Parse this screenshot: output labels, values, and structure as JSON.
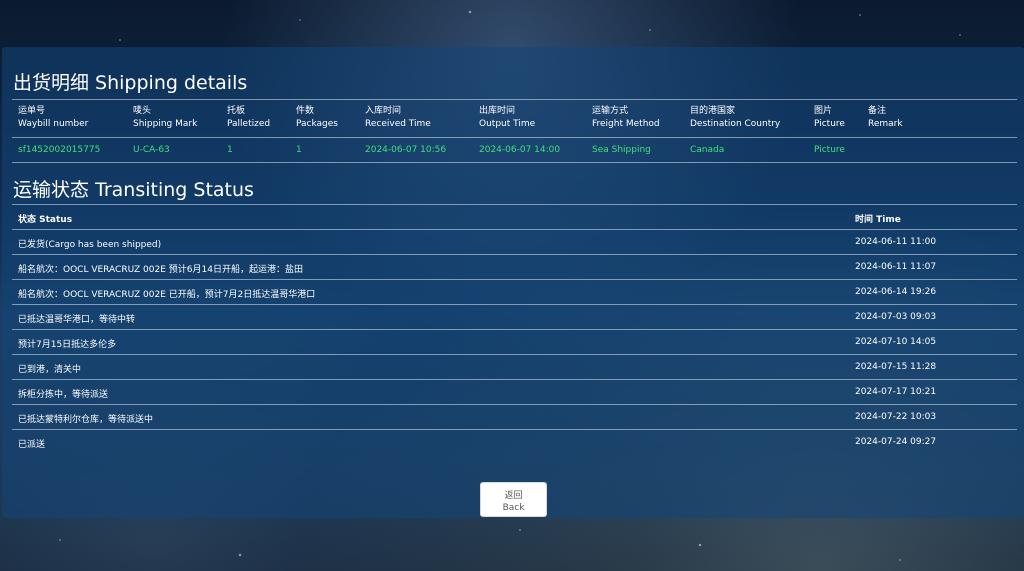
{
  "shipping": {
    "title": "出货明细 Shipping details",
    "headers": [
      {
        "zh": "运单号",
        "en": "Waybill number"
      },
      {
        "zh": "唛头",
        "en": "Shipping Mark"
      },
      {
        "zh": "托板",
        "en": "Palletized"
      },
      {
        "zh": "件数",
        "en": "Packages"
      },
      {
        "zh": "入库时间",
        "en": "Received Time"
      },
      {
        "zh": "出库时间",
        "en": "Output Time"
      },
      {
        "zh": "运输方式",
        "en": "Freight Method"
      },
      {
        "zh": "目的港国家",
        "en": "Destination Country"
      },
      {
        "zh": "图片",
        "en": "Picture"
      },
      {
        "zh": "备注",
        "en": "Remark"
      }
    ],
    "row": {
      "waybill": "sf1452002015775",
      "mark": "U-CA-63",
      "palletized": "1",
      "packages": "1",
      "received": "2024-06-07 10:56",
      "output": "2024-06-07 14:00",
      "freight": "Sea Shipping",
      "country": "Canada",
      "picture": "Picture",
      "remark": ""
    },
    "value_color": "#3fe07a"
  },
  "transit": {
    "title": "运输状态 Transiting Status",
    "head_status": "状态 Status",
    "head_time": "时间 Time",
    "rows": [
      {
        "status": "已发货(Cargo has been shipped)",
        "time": "2024-06-11 11:00"
      },
      {
        "status": "船名航次：OOCL VERACRUZ 002E 预计6月14日开船，起运港：盐田",
        "time": "2024-06-11 11:07"
      },
      {
        "status": "船名航次：OOCL VERACRUZ 002E 已开船，预计7月2日抵达温哥华港口",
        "time": "2024-06-14 19:26"
      },
      {
        "status": "已抵达温哥华港口，等待中转",
        "time": "2024-07-03 09:03"
      },
      {
        "status": "预计7月15日抵达多伦多",
        "time": "2024-07-10 14:05"
      },
      {
        "status": "已到港，清关中",
        "time": "2024-07-15 11:28"
      },
      {
        "status": "拆柜分拣中，等待派送",
        "time": "2024-07-17 10:21"
      },
      {
        "status": "已抵达蒙特利尔仓库，等待派送中",
        "time": "2024-07-22 10:03"
      },
      {
        "status": "已派送",
        "time": "2024-07-24 09:27"
      }
    ]
  },
  "back_button": {
    "zh": "返回",
    "en": "Back"
  }
}
